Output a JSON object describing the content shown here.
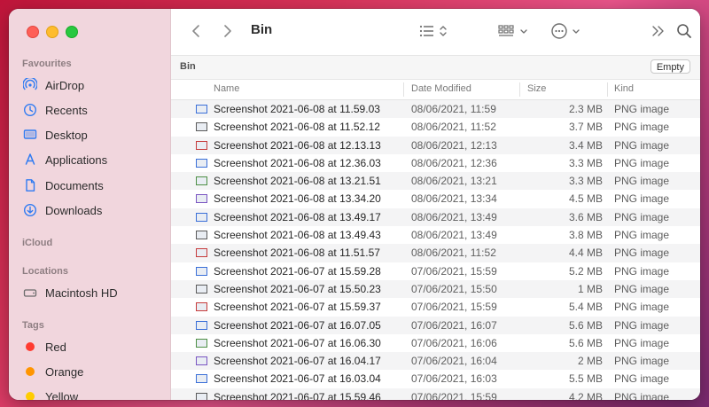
{
  "window": {
    "title": "Bin"
  },
  "sidebar": {
    "favourites_label": "Favourites",
    "favourites": [
      {
        "label": "AirDrop",
        "icon": "airdrop-icon"
      },
      {
        "label": "Recents",
        "icon": "clock-icon"
      },
      {
        "label": "Desktop",
        "icon": "desktop-icon"
      },
      {
        "label": "Applications",
        "icon": "applications-icon"
      },
      {
        "label": "Documents",
        "icon": "document-icon"
      },
      {
        "label": "Downloads",
        "icon": "download-icon"
      }
    ],
    "icloud_label": "iCloud",
    "locations_label": "Locations",
    "locations": [
      {
        "label": "Macintosh HD",
        "icon": "disk-icon"
      }
    ],
    "tags_label": "Tags",
    "tags": [
      {
        "label": "Red",
        "color": "#ff3b30"
      },
      {
        "label": "Orange",
        "color": "#ff9500"
      },
      {
        "label": "Yellow",
        "color": "#ffcc00"
      }
    ]
  },
  "toolbar": {
    "back": "chevron-left-icon",
    "forward": "chevron-right-icon",
    "view_list": "list-view-icon",
    "group": "grid-group-icon",
    "action": "ellipsis-circle-icon",
    "more": "double-chevron-icon",
    "search": "search-icon"
  },
  "pathbar": {
    "title": "Bin",
    "empty_label": "Empty"
  },
  "columns": {
    "name": "Name",
    "date": "Date Modified",
    "size": "Size",
    "kind": "Kind"
  },
  "files": [
    {
      "name": "Screenshot 2021-06-08 at 11.59.03",
      "date": "08/06/2021, 11:59",
      "size": "2.3 MB",
      "kind": "PNG image"
    },
    {
      "name": "Screenshot 2021-06-08 at 11.52.12",
      "date": "08/06/2021, 11:52",
      "size": "3.7 MB",
      "kind": "PNG image"
    },
    {
      "name": "Screenshot 2021-06-08 at 12.13.13",
      "date": "08/06/2021, 12:13",
      "size": "3.4 MB",
      "kind": "PNG image"
    },
    {
      "name": "Screenshot 2021-06-08 at 12.36.03",
      "date": "08/06/2021, 12:36",
      "size": "3.3 MB",
      "kind": "PNG image"
    },
    {
      "name": "Screenshot 2021-06-08 at 13.21.51",
      "date": "08/06/2021, 13:21",
      "size": "3.3 MB",
      "kind": "PNG image"
    },
    {
      "name": "Screenshot 2021-06-08 at 13.34.20",
      "date": "08/06/2021, 13:34",
      "size": "4.5 MB",
      "kind": "PNG image"
    },
    {
      "name": "Screenshot 2021-06-08 at 13.49.17",
      "date": "08/06/2021, 13:49",
      "size": "3.6 MB",
      "kind": "PNG image"
    },
    {
      "name": "Screenshot 2021-06-08 at 13.49.43",
      "date": "08/06/2021, 13:49",
      "size": "3.8 MB",
      "kind": "PNG image"
    },
    {
      "name": "Screenshot 2021-06-08 at 11.51.57",
      "date": "08/06/2021, 11:52",
      "size": "4.4 MB",
      "kind": "PNG image"
    },
    {
      "name": "Screenshot 2021-06-07 at 15.59.28",
      "date": "07/06/2021, 15:59",
      "size": "5.2 MB",
      "kind": "PNG image"
    },
    {
      "name": "Screenshot 2021-06-07 at 15.50.23",
      "date": "07/06/2021, 15:50",
      "size": "1 MB",
      "kind": "PNG image"
    },
    {
      "name": "Screenshot 2021-06-07 at 15.59.37",
      "date": "07/06/2021, 15:59",
      "size": "5.4 MB",
      "kind": "PNG image"
    },
    {
      "name": "Screenshot 2021-06-07 at 16.07.05",
      "date": "07/06/2021, 16:07",
      "size": "5.6 MB",
      "kind": "PNG image"
    },
    {
      "name": "Screenshot 2021-06-07 at 16.06.30",
      "date": "07/06/2021, 16:06",
      "size": "5.6 MB",
      "kind": "PNG image"
    },
    {
      "name": "Screenshot 2021-06-07 at 16.04.17",
      "date": "07/06/2021, 16:04",
      "size": "2 MB",
      "kind": "PNG image"
    },
    {
      "name": "Screenshot 2021-06-07 at 16.03.04",
      "date": "07/06/2021, 16:03",
      "size": "5.5 MB",
      "kind": "PNG image"
    },
    {
      "name": "Screenshot 2021-06-07 at 15.59.46",
      "date": "07/06/2021, 15:59",
      "size": "4.2 MB",
      "kind": "PNG image"
    }
  ],
  "colors": {
    "accent": "#1f6fde",
    "sidebar_bg": "#f1d6dd"
  }
}
